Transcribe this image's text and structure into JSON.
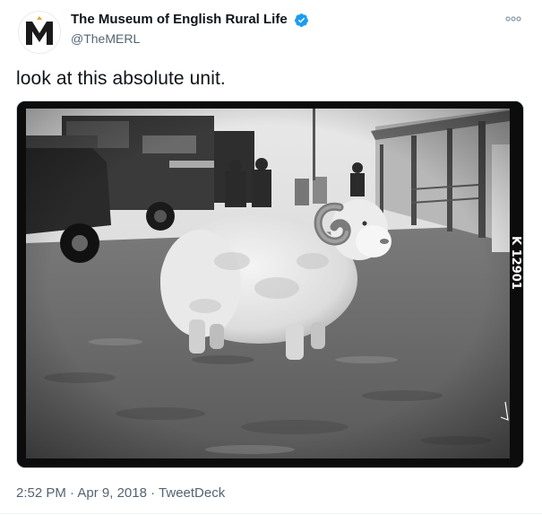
{
  "account": {
    "display_name": "The Museum of English Rural Life",
    "handle": "@TheMERL",
    "verified": true,
    "avatar_icon": "merl-m-logo",
    "avatar_letter": "M"
  },
  "tweet": {
    "text": "look at this absolute unit."
  },
  "media": {
    "film_edge_code": "K 12901"
  },
  "meta": {
    "time": "2:52 PM",
    "separator1": "·",
    "date": "Apr 9, 2018",
    "separator2": "·",
    "source": "TweetDeck"
  },
  "colors": {
    "text_primary": "#0f1419",
    "text_secondary": "#536471",
    "verified_blue": "#1d9bf0",
    "border": "#cfd9de"
  }
}
